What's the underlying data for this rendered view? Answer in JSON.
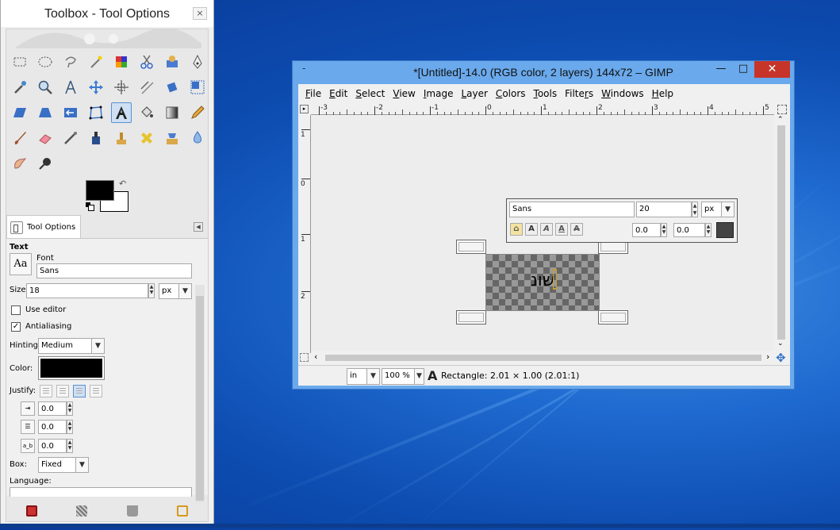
{
  "toolbox": {
    "title": "Toolbox - Tool Options",
    "close": "×",
    "tab_label": "Tool Options",
    "section": "Text",
    "font_label": "Font",
    "font_preview": "Aa",
    "font_value": "Sans",
    "size_label": "Size:",
    "size_value": "18",
    "size_unit": "px",
    "use_editor": "Use editor",
    "use_editor_checked": false,
    "antialiasing": "Antialiasing",
    "antialiasing_checked": true,
    "hinting_label": "Hinting:",
    "hinting_value": "Medium",
    "color_label": "Color:",
    "justify_label": "Justify:",
    "indent_value": "0.0",
    "line_spacing_value": "0.0",
    "letter_spacing_value": "0.0",
    "letter_spacing_icon": "a_b",
    "box_label": "Box:",
    "box_value": "Fixed",
    "language_label": "Language:",
    "fg_color": "#000000",
    "bg_color": "#ffffff",
    "swap_glyph": "↶"
  },
  "gimp": {
    "title": "*[Untitled]-14.0 (RGB color, 2 layers) 144x72 – GIMP",
    "title_dash": "-",
    "min_glyph": "—",
    "max_glyph": "□",
    "close_glyph": "✕",
    "menu": [
      "File",
      "Edit",
      "Select",
      "View",
      "Image",
      "Layer",
      "Colors",
      "Tools",
      "Filters",
      "Windows",
      "Help"
    ],
    "menu_underline": [
      "F",
      "E",
      "S",
      "V",
      "I",
      "L",
      "C",
      "T",
      "r",
      "W",
      "H"
    ],
    "hruler": [
      "-3",
      "-2",
      "-1",
      "0",
      "1",
      "2",
      "3",
      "4",
      "5"
    ],
    "vruler": [
      "1",
      "0",
      "1",
      "2"
    ],
    "style_font": "Sans",
    "style_size": "20",
    "style_unit": "px",
    "style_baseline": "0.0",
    "style_kerning": "0.0",
    "style_btns": [
      "A",
      "A",
      "A",
      "A"
    ],
    "canvas_text": "שונ",
    "unit": "in",
    "zoom": "100 %",
    "status": "Rectangle: 2.01 × 1.00  (2.01:1)",
    "status_icon": "A"
  }
}
